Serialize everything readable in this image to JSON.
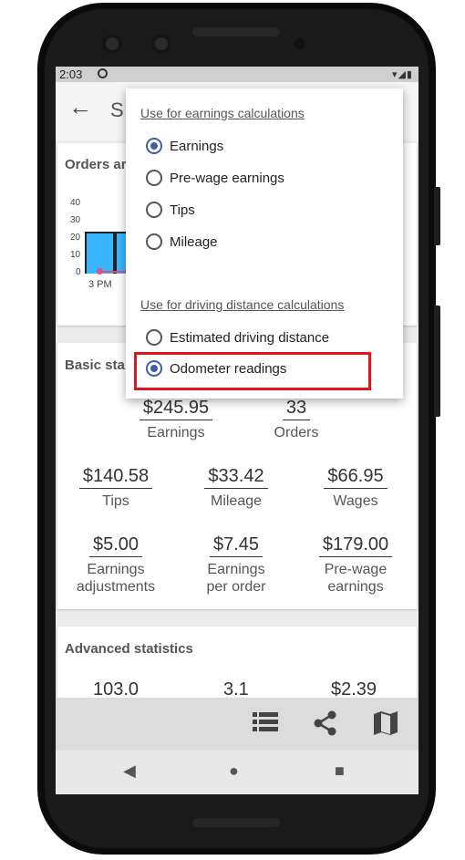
{
  "status_bar": {
    "time": "2:03",
    "right_icons": "▾◢▮"
  },
  "appbar": {
    "back_glyph": "←",
    "title_partial": "S"
  },
  "orders_card": {
    "title": "Orders ar",
    "chart_data": {
      "type": "bar",
      "categories": [
        "3 PM",
        "3 PM+"
      ],
      "values": [
        24,
        24
      ],
      "line_values": [
        1,
        1
      ],
      "ylim": [
        0,
        40
      ],
      "yticks": [
        "40",
        "30",
        "20",
        "10",
        "0"
      ],
      "xtick": "3 PM"
    }
  },
  "basic_stats": {
    "title": "Basic sta",
    "row1": [
      {
        "value": "$245.95",
        "label": "Earnings"
      },
      {
        "value": "33",
        "label": "Orders"
      }
    ],
    "row2": [
      {
        "value": "$140.58",
        "label": "Tips"
      },
      {
        "value": "$33.42",
        "label": "Mileage"
      },
      {
        "value": "$66.95",
        "label": "Wages"
      }
    ],
    "row3": [
      {
        "value": "$5.00",
        "label": "Earnings adjustments"
      },
      {
        "value": "$7.45",
        "label": "Earnings per order"
      },
      {
        "value": "$179.00",
        "label": "Pre-wage earnings"
      }
    ]
  },
  "advanced_stats": {
    "title": "Advanced statistics",
    "values": [
      "103.0",
      "3.1",
      "$2.39"
    ]
  },
  "toolbar": {
    "list_icon": "list-icon",
    "share_icon": "share-icon",
    "map_icon": "map-icon"
  },
  "nav": {
    "back": "◀",
    "home": "●",
    "recents": "■"
  },
  "popup": {
    "earnings_header": "Use for earnings calculations",
    "earnings_options": [
      {
        "label": "Earnings",
        "checked": true
      },
      {
        "label": "Pre-wage earnings",
        "checked": false
      },
      {
        "label": "Tips",
        "checked": false
      },
      {
        "label": "Mileage",
        "checked": false
      }
    ],
    "distance_header": "Use for driving distance calculations",
    "distance_options": [
      {
        "label": "Estimated driving distance",
        "checked": false
      },
      {
        "label": "Odometer readings",
        "checked": true
      }
    ]
  },
  "colors": {
    "accent": "#3f5fa8",
    "highlight": "#e0161f",
    "bar": "#38b6ff"
  }
}
